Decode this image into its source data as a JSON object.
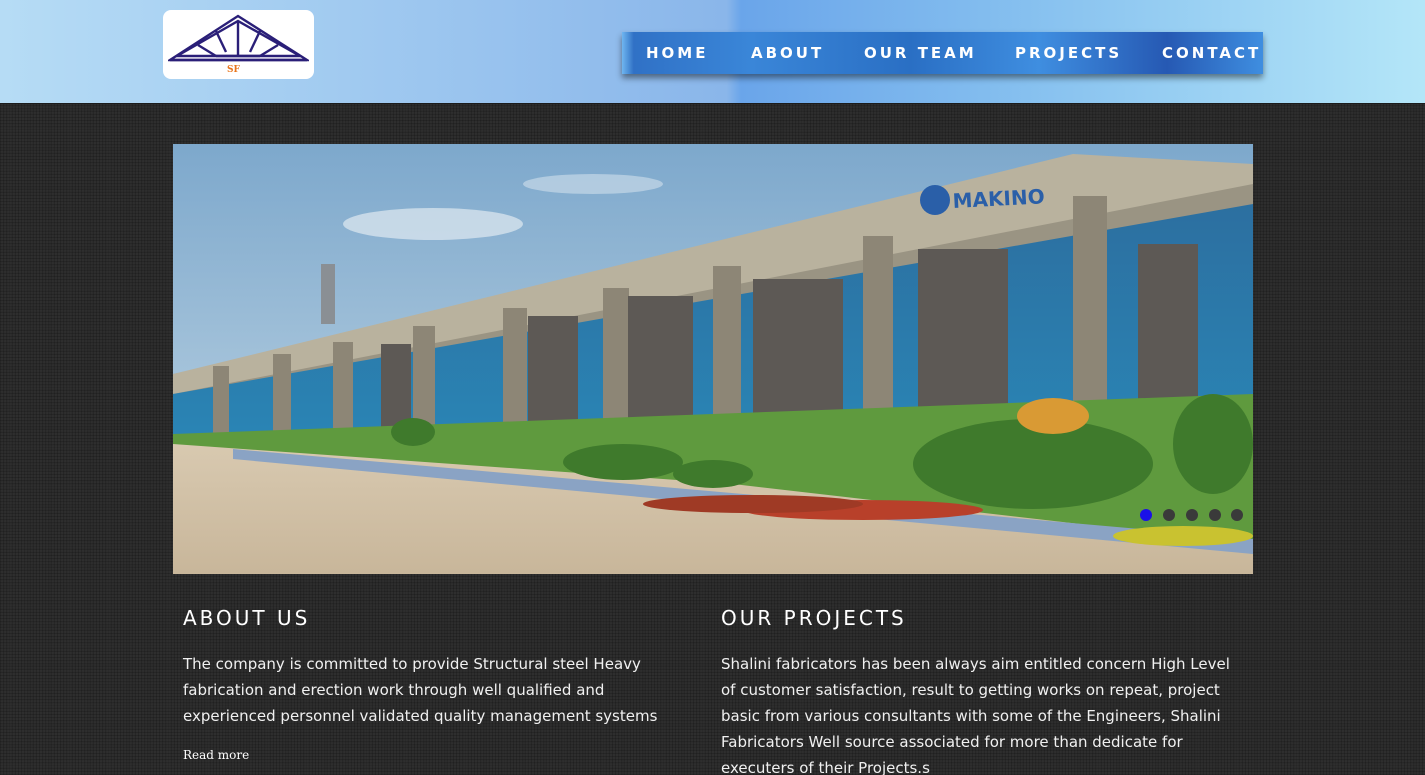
{
  "header": {
    "logo_text": "SF",
    "brand_color": "#e8741a"
  },
  "nav": {
    "items": [
      {
        "label": "HOME"
      },
      {
        "label": "ABOUT"
      },
      {
        "label": "OUR TEAM"
      },
      {
        "label": "PROJECTS"
      },
      {
        "label": "CONTACT"
      }
    ],
    "color": "#2f6fc4"
  },
  "slider": {
    "image_icon": "factory-building-photo",
    "sign_text": "MAKINO",
    "slide_count": 5,
    "active_slide": 1,
    "active_dot_color": "#1a10e8"
  },
  "about": {
    "title": "ABOUT US",
    "text": "The company is committed to provide Structural steel Heavy fabrication and erection work through well qualified and experienced personnel validated quality management systems",
    "read_more": "Read more"
  },
  "projects": {
    "title": "OUR PROJECTS",
    "text": "Shalini fabricators has been always aim entitled concern High Level of customer satisfaction, result to getting works on repeat, project basic from various consultants with some of the Engineers, Shalini Fabricators Well source associated for more than dedicate for executers of their Projects.s"
  }
}
